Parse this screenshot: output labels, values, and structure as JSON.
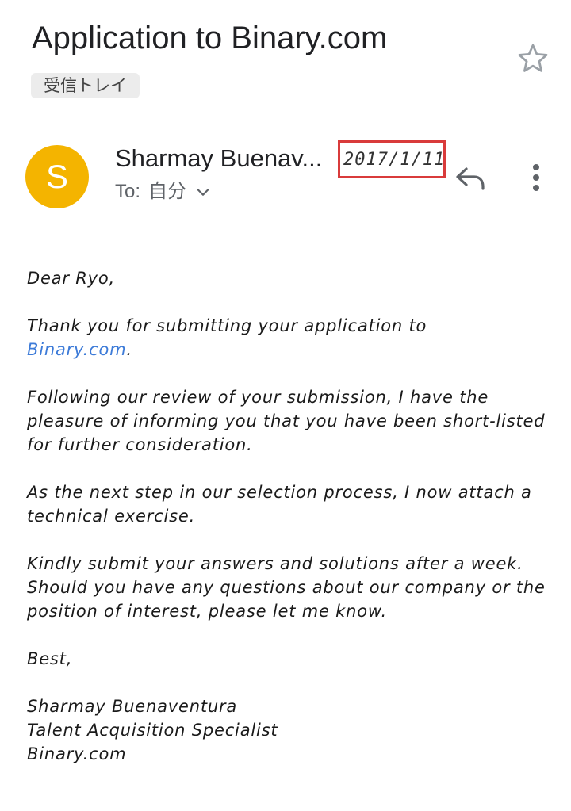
{
  "email": {
    "subject": "Application to Binary.com",
    "label": "受信トレイ",
    "sender": {
      "initial": "S",
      "name": "Sharmay Buenav...",
      "avatar_color": "#f4b400"
    },
    "date": "2017/1/11",
    "to_prefix": "To:",
    "to_value": "自分"
  },
  "body": {
    "greeting": "Dear Ryo,",
    "p1_text": "Thank you for submitting your application to",
    "p1_link": "Binary.com",
    "p1_end": ".",
    "p2": "Following our review of your submission, I have the pleasure of informing you that you have been short-listed for further consideration.",
    "p3": "As the next step in our selection process, I now attach a technical exercise.",
    "p4": "Kindly submit your answers and solutions after a week. Should you have any questions about our company or the position of interest, please let me know.",
    "closing": "Best,",
    "sig_name": "Sharmay Buenaventura",
    "sig_title": "Talent Acquisition Specialist",
    "sig_company": "Binary.com"
  },
  "icons": {
    "star": "star-icon",
    "reply": "reply-icon",
    "more": "more-vert-icon",
    "expand": "chevron-down-icon"
  },
  "colors": {
    "highlight_box": "#d93b3b",
    "link": "#3d7bd8"
  }
}
